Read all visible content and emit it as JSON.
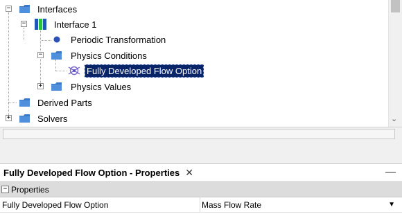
{
  "tree": {
    "items": [
      {
        "label": "Interfaces",
        "icon": "folder-icon",
        "expanded": true
      },
      {
        "label": "Interface 1",
        "icon": "interface-icon",
        "expanded": true
      },
      {
        "label": "Periodic Transformation",
        "icon": "dot-icon"
      },
      {
        "label": "Physics Conditions",
        "icon": "folder-icon",
        "expanded": true
      },
      {
        "label": "Fully Developed Flow Option",
        "icon": "physics-condition-icon",
        "selected": true
      },
      {
        "label": "Physics Values",
        "icon": "folder-icon",
        "expanded": false
      },
      {
        "label": "Derived Parts",
        "icon": "folder-icon"
      },
      {
        "label": "Solvers",
        "icon": "folder-icon",
        "expanded": false
      }
    ]
  },
  "properties_panel": {
    "title": "Fully Developed Flow Option - Properties",
    "close_glyph": "✕",
    "minimize_glyph": "—",
    "group_label": "Properties",
    "rows": [
      {
        "name": "Fully Developed Flow Option",
        "value": "Mass Flow Rate"
      }
    ]
  },
  "colors": {
    "selection_bg": "#0a246a",
    "folder_blue": "#3a78c8"
  }
}
